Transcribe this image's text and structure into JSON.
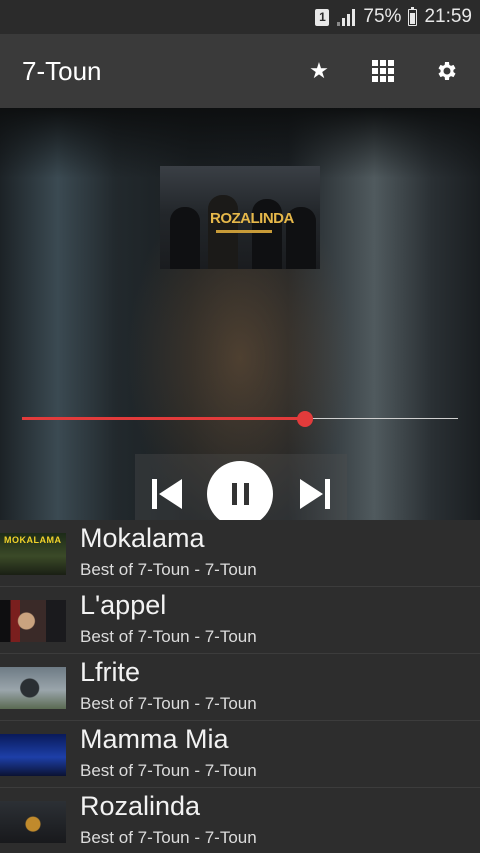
{
  "status_bar": {
    "sim_label": "1",
    "battery_percent": "75%",
    "time": "21:59"
  },
  "app_bar": {
    "title": "7-Toun",
    "actions": [
      "star-icon",
      "grid-icon",
      "gear-icon"
    ]
  },
  "player": {
    "cover_text": "ROZALINDA",
    "progress": 0.65,
    "state": "playing",
    "controls": [
      "previous",
      "pause",
      "next"
    ]
  },
  "playlist": [
    {
      "title": "Mokalama",
      "subtitle": "Best of 7-Toun - 7-Toun",
      "thumb_text": "MOKALAMA"
    },
    {
      "title": "L'appel",
      "subtitle": "Best of 7-Toun - 7-Toun"
    },
    {
      "title": "Lfrite",
      "subtitle": "Best of 7-Toun - 7-Toun"
    },
    {
      "title": "Mamma Mia",
      "subtitle": "Best of 7-Toun - 7-Toun"
    },
    {
      "title": "Rozalinda",
      "subtitle": "Best of 7-Toun - 7-Toun"
    }
  ],
  "colors": {
    "accent": "#e23b3b",
    "app_bar": "#3a3a3a",
    "list_bg": "#2d2d2d"
  }
}
